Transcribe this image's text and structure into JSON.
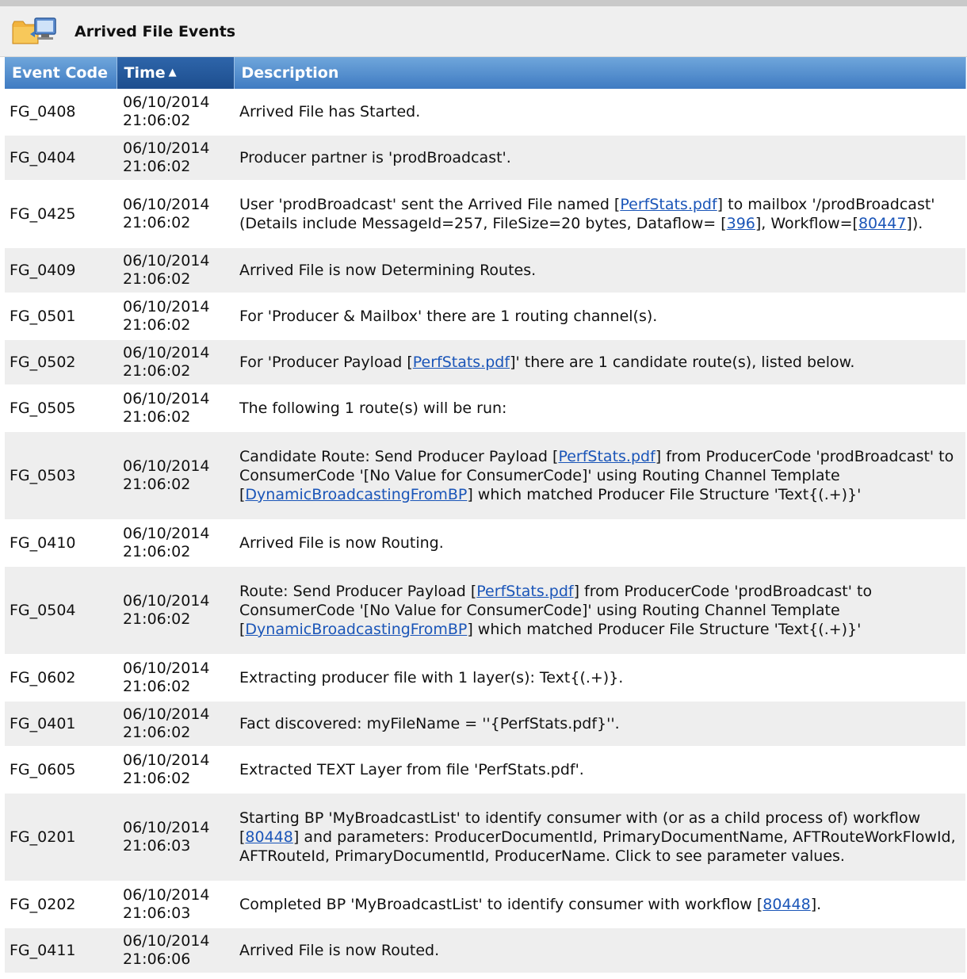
{
  "panel": {
    "title": "Arrived File Events",
    "icon": "folder-transfer-icon"
  },
  "columns": [
    {
      "label": "Event Code"
    },
    {
      "label": "Time",
      "sort": "ascending"
    },
    {
      "label": "Description"
    }
  ],
  "rows": [
    {
      "code": "FG_0408",
      "date": "06/10/2014",
      "time": "21:06:02",
      "desc": [
        {
          "t": "Arrived File has Started."
        }
      ]
    },
    {
      "code": "FG_0404",
      "date": "06/10/2014",
      "time": "21:06:02",
      "desc": [
        {
          "t": "Producer partner is 'prodBroadcast'."
        }
      ]
    },
    {
      "code": "FG_0425",
      "date": "06/10/2014",
      "time": "21:06:02",
      "desc": [
        {
          "t": "User 'prodBroadcast' sent the Arrived File named ["
        },
        {
          "t": "PerfStats.pdf",
          "link": true
        },
        {
          "t": "] to mailbox '/prodBroadcast' (Details include MessageId=257, FileSize=20 bytes, Dataflow= ["
        },
        {
          "t": "396",
          "link": true
        },
        {
          "t": "], Workflow=["
        },
        {
          "t": "80447",
          "link": true
        },
        {
          "t": "])."
        }
      ]
    },
    {
      "code": "FG_0409",
      "date": "06/10/2014",
      "time": "21:06:02",
      "desc": [
        {
          "t": "Arrived File is now Determining Routes."
        }
      ]
    },
    {
      "code": "FG_0501",
      "date": "06/10/2014",
      "time": "21:06:02",
      "desc": [
        {
          "t": "For 'Producer & Mailbox' there are 1 routing channel(s)."
        }
      ]
    },
    {
      "code": "FG_0502",
      "date": "06/10/2014",
      "time": "21:06:02",
      "desc": [
        {
          "t": "For 'Producer Payload ["
        },
        {
          "t": "PerfStats.pdf",
          "link": true
        },
        {
          "t": "]' there are 1 candidate route(s), listed below."
        }
      ]
    },
    {
      "code": "FG_0505",
      "date": "06/10/2014",
      "time": "21:06:02",
      "desc": [
        {
          "t": "The following 1 route(s) will be run:"
        }
      ]
    },
    {
      "code": "FG_0503",
      "date": "06/10/2014",
      "time": "21:06:02",
      "desc": [
        {
          "t": "Candidate Route: Send Producer Payload ["
        },
        {
          "t": "PerfStats.pdf",
          "link": true
        },
        {
          "t": "] from ProducerCode 'prodBroadcast' to ConsumerCode '[No Value for ConsumerCode]' using Routing Channel Template ["
        },
        {
          "t": "DynamicBroadcastingFromBP",
          "link": true
        },
        {
          "t": "] which matched Producer File Structure 'Text{(.+)}'"
        }
      ]
    },
    {
      "code": "FG_0410",
      "date": "06/10/2014",
      "time": "21:06:02",
      "desc": [
        {
          "t": "Arrived File is now Routing."
        }
      ]
    },
    {
      "code": "FG_0504",
      "date": "06/10/2014",
      "time": "21:06:02",
      "desc": [
        {
          "t": "Route: Send Producer Payload ["
        },
        {
          "t": "PerfStats.pdf",
          "link": true
        },
        {
          "t": "] from ProducerCode 'prodBroadcast' to ConsumerCode '[No Value for ConsumerCode]' using Routing Channel Template ["
        },
        {
          "t": "DynamicBroadcastingFromBP",
          "link": true
        },
        {
          "t": "] which matched Producer File Structure 'Text{(.+)}'"
        }
      ]
    },
    {
      "code": "FG_0602",
      "date": "06/10/2014",
      "time": "21:06:02",
      "desc": [
        {
          "t": "Extracting producer file with 1 layer(s): Text{(.+)}."
        }
      ]
    },
    {
      "code": "FG_0401",
      "date": "06/10/2014",
      "time": "21:06:02",
      "desc": [
        {
          "t": "Fact discovered: myFileName = ''{PerfStats.pdf}''."
        }
      ]
    },
    {
      "code": "FG_0605",
      "date": "06/10/2014",
      "time": "21:06:02",
      "desc": [
        {
          "t": "Extracted TEXT Layer from file 'PerfStats.pdf'."
        }
      ]
    },
    {
      "code": "FG_0201",
      "date": "06/10/2014",
      "time": "21:06:03",
      "desc": [
        {
          "t": "Starting BP 'MyBroadcastList' to identify consumer with (or as a child process of) workflow ["
        },
        {
          "t": "80448",
          "link": true
        },
        {
          "t": "] and parameters: ProducerDocumentId, PrimaryDocumentName, AFTRouteWorkFlowId, AFTRouteId, PrimaryDocumentId, ProducerName. Click to see parameter values."
        }
      ]
    },
    {
      "code": "FG_0202",
      "date": "06/10/2014",
      "time": "21:06:03",
      "desc": [
        {
          "t": "Completed BP 'MyBroadcastList' to identify consumer with workflow ["
        },
        {
          "t": "80448",
          "link": true
        },
        {
          "t": "]."
        }
      ]
    },
    {
      "code": "FG_0411",
      "date": "06/10/2014",
      "time": "21:06:06",
      "desc": [
        {
          "t": "Arrived File is now Routed."
        }
      ]
    }
  ]
}
